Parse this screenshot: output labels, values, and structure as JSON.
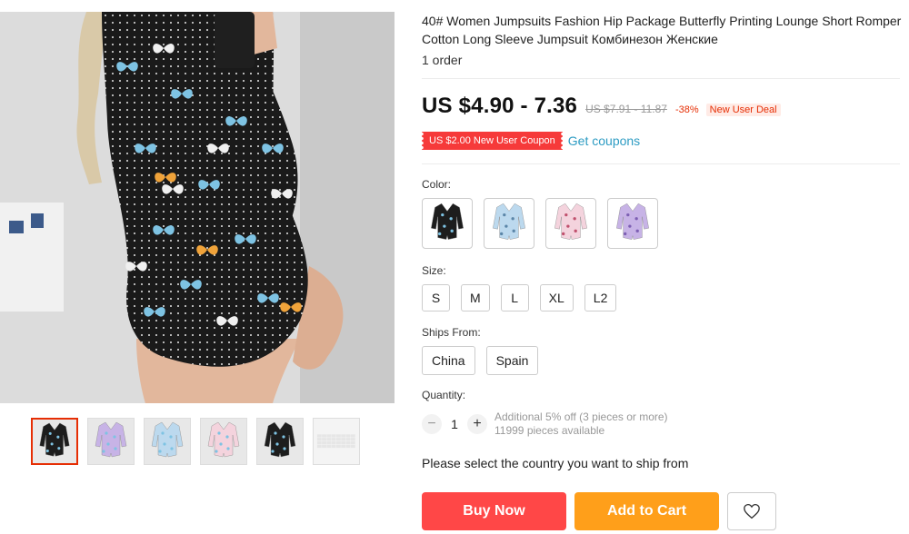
{
  "product": {
    "title": "40# Women Jumpsuits Fashion Hip Package Butterfly Printing Lounge Short Romper Cotton Long Sleeve Jumpsuit Комбинезон Женские",
    "orders": "1 order"
  },
  "price": {
    "current": "US $4.90 - 7.36",
    "original": "US $7.91 - 11.87",
    "discount": "-38%",
    "deal_badge": "New User Deal"
  },
  "coupon": {
    "label": "US $2.00 New User Coupon",
    "link": "Get coupons"
  },
  "color": {
    "label": "Color:",
    "options": [
      {
        "name": "black-butterfly",
        "fabric": "#1d1d1d",
        "print": "#7ec3e3"
      },
      {
        "name": "light-blue",
        "fabric": "#bcd9ee",
        "print": "#5b86a8"
      },
      {
        "name": "pink",
        "fabric": "#f4d3dd",
        "print": "#c0506d"
      },
      {
        "name": "purple",
        "fabric": "#c7b3e6",
        "print": "#7d5fb3"
      }
    ]
  },
  "size": {
    "label": "Size:",
    "options": [
      "S",
      "M",
      "L",
      "XL",
      "L2"
    ]
  },
  "ships_from": {
    "label": "Ships From:",
    "options": [
      "China",
      "Spain"
    ]
  },
  "quantity": {
    "label": "Quantity:",
    "minus": "−",
    "value": "1",
    "plus": "+",
    "note": "Additional 5% off (3 pieces or more)",
    "available": "11999 pieces available"
  },
  "ship_message": "Please select the country you want to ship from",
  "actions": {
    "buy_now": "Buy Now",
    "add_to_cart": "Add to Cart"
  },
  "thumbnails": [
    {
      "name": "black-back",
      "fabric": "#1d1d1d",
      "selected": true
    },
    {
      "name": "purple-front",
      "fabric": "#c7b3e6",
      "selected": false
    },
    {
      "name": "blue-front",
      "fabric": "#bcd9ee",
      "selected": false
    },
    {
      "name": "pink-front",
      "fabric": "#f4d3dd",
      "selected": false
    },
    {
      "name": "black-front",
      "fabric": "#1d1d1d",
      "selected": false
    },
    {
      "name": "size-chart",
      "fabric": "#ffffff",
      "selected": false
    }
  ],
  "colors": {
    "buy_now": "#ff4747",
    "add_to_cart": "#ff9f1a",
    "coupon": "#f63a3a",
    "link": "#2e9cc3",
    "discount": "#e62e04"
  }
}
